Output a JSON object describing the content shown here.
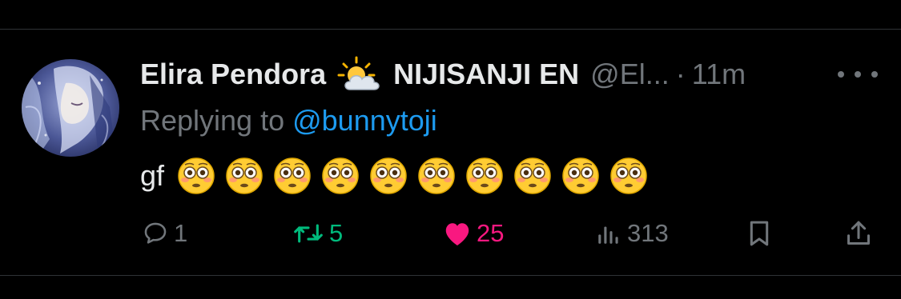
{
  "tweet": {
    "author": {
      "display_name": "Elira Pendora",
      "affiliation": "NIJISANJI EN",
      "handle": "@El...",
      "badge_icon": "sun-behind-cloud-emoji",
      "avatar_icon": "avatar-image"
    },
    "separator": "·",
    "time": "11m",
    "reply_prefix": "Replying to",
    "reply_handle": "@bunnytoji",
    "text": "gf",
    "emoji_name": "flushed-face-emoji",
    "emoji_count": 10,
    "actions": {
      "replies": "1",
      "retweets": "5",
      "likes": "25",
      "views": "313"
    }
  },
  "colors": {
    "background": "#000000",
    "primary_text": "#e7e9ea",
    "secondary_text": "#71767b",
    "link": "#1d9bf0",
    "retweet_active": "#00ba7c",
    "like_active": "#f91880",
    "divider": "#2f3336"
  }
}
